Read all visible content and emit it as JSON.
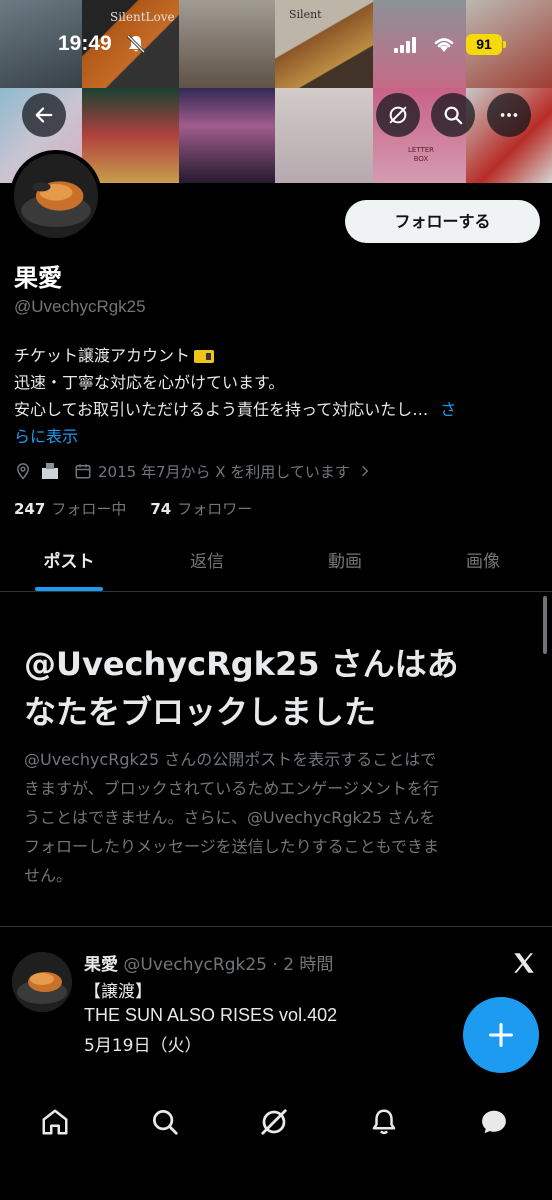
{
  "status_bar": {
    "time": "19:49",
    "battery": "91"
  },
  "banner": {
    "label_silentlove": "SilentLove",
    "label_silent": "Silent",
    "label_letterbox": "LETTER BOX"
  },
  "profile": {
    "display_name": "果愛",
    "handle": "@UvechycRgk25",
    "follow_label": "フォローする",
    "bio_lines": [
      "チケット譲渡アカウント",
      "迅速・丁寧な対応を心がけています。",
      "安心してお取引いただけるよう責任を持って対応いたし…"
    ],
    "bio_more_a": "さ",
    "bio_more_b": "らに表示",
    "joined": "2015 年7月から X を利用しています",
    "following_count": "247",
    "following_label": "フォロー中",
    "followers_count": "74",
    "followers_label": "フォロワー"
  },
  "tabs": [
    {
      "label": "ポスト",
      "active": true
    },
    {
      "label": "返信"
    },
    {
      "label": "動画"
    },
    {
      "label": "画像"
    }
  ],
  "blocked": {
    "title_line1": "@UvechycRgk25 さんはあ",
    "title_line2": "なたをブロックしました",
    "desc_lines": [
      "@UvechycRgk25 さんの公開ポストを表示することはで",
      "きますが、ブロックされているためエンゲージメントを行",
      "うことはできません。さらに、@UvechycRgk25 さんを",
      "フォローしたりメッセージを送信したりすることもできま",
      "せん。"
    ]
  },
  "post": {
    "name": "果愛",
    "meta": "@UvechycRgk25 · 2 時間",
    "lines": [
      "【譲渡】",
      "THE SUN ALSO RISES vol.402",
      "5月19日（火）"
    ]
  },
  "colors": {
    "accent": "#1d9bf0",
    "muted": "#71767b",
    "text": "#e7e9ea",
    "battery": "#f5d90a"
  },
  "icons": {
    "header": [
      "back-arrow-icon",
      "grok-icon",
      "search-icon",
      "more-icon"
    ],
    "bottom_nav": [
      "home-icon",
      "search-icon",
      "grok-icon",
      "notifications-icon",
      "messages-icon"
    ]
  }
}
